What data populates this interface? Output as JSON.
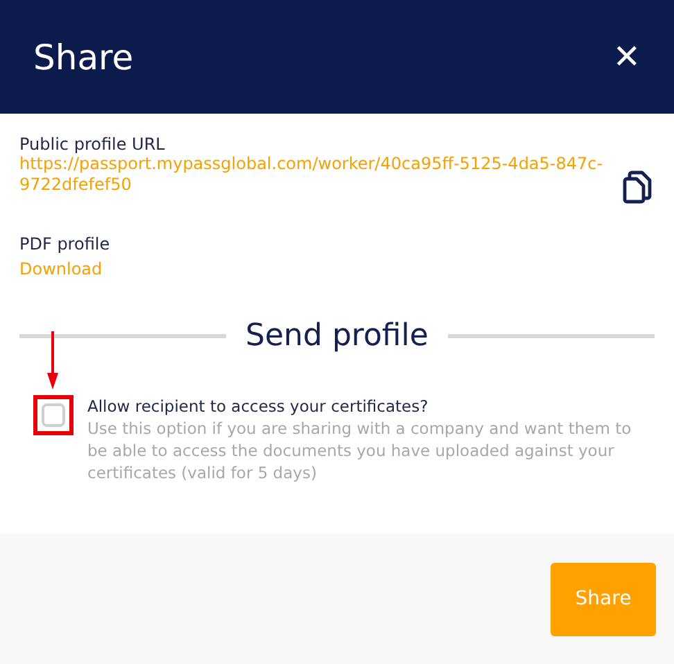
{
  "dialog": {
    "title": "Share",
    "close": "✕"
  },
  "public_url": {
    "label": "Public profile URL",
    "value": "https://passport.mypassglobal.com/worker/40ca95ff-5125-4da5-847c-9722dfefef50"
  },
  "pdf": {
    "label": "PDF profile",
    "link": "Download"
  },
  "section": {
    "title": "Send profile"
  },
  "option": {
    "label": "Allow recipient to access your certificates?",
    "description": "Use this option if you are sharing with a company and want them to be able to access the documents you have uploaded against your certificates (valid for 5 days)",
    "checked": false
  },
  "buttons": [
    "Share"
  ]
}
